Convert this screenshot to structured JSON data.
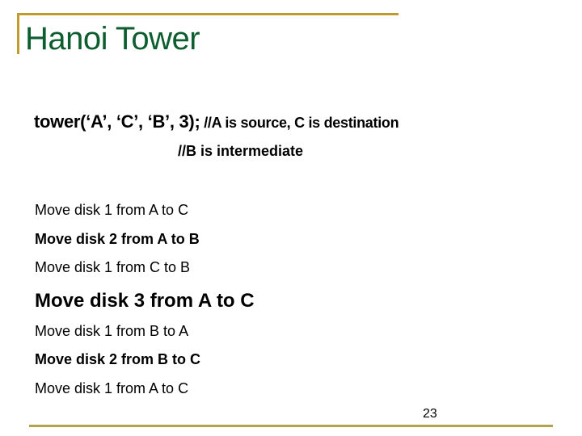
{
  "slide": {
    "title": "Hanoi Tower",
    "call_code": "tower(‘A’, ‘C’, ‘B’, 3);",
    "call_comment": " //A is source, C is destination",
    "call_comment_2": "//B is intermediate",
    "moves": [
      {
        "text": "Move disk 1 from A to C"
      },
      {
        "text": "Move disk 2 from A to B"
      },
      {
        "text": "Move disk 1 from C to B"
      },
      {
        "text": "Move disk 3 from A to C"
      },
      {
        "text": "Move disk 1 from B to A"
      },
      {
        "text": "Move disk 2 from B to C"
      },
      {
        "text": "Move disk 1 from A to C"
      }
    ],
    "page_number": "23",
    "colors": {
      "title": "#0d5e2f",
      "accent_line": "#c09a2a",
      "bottom_line": "#b5a24a"
    }
  }
}
